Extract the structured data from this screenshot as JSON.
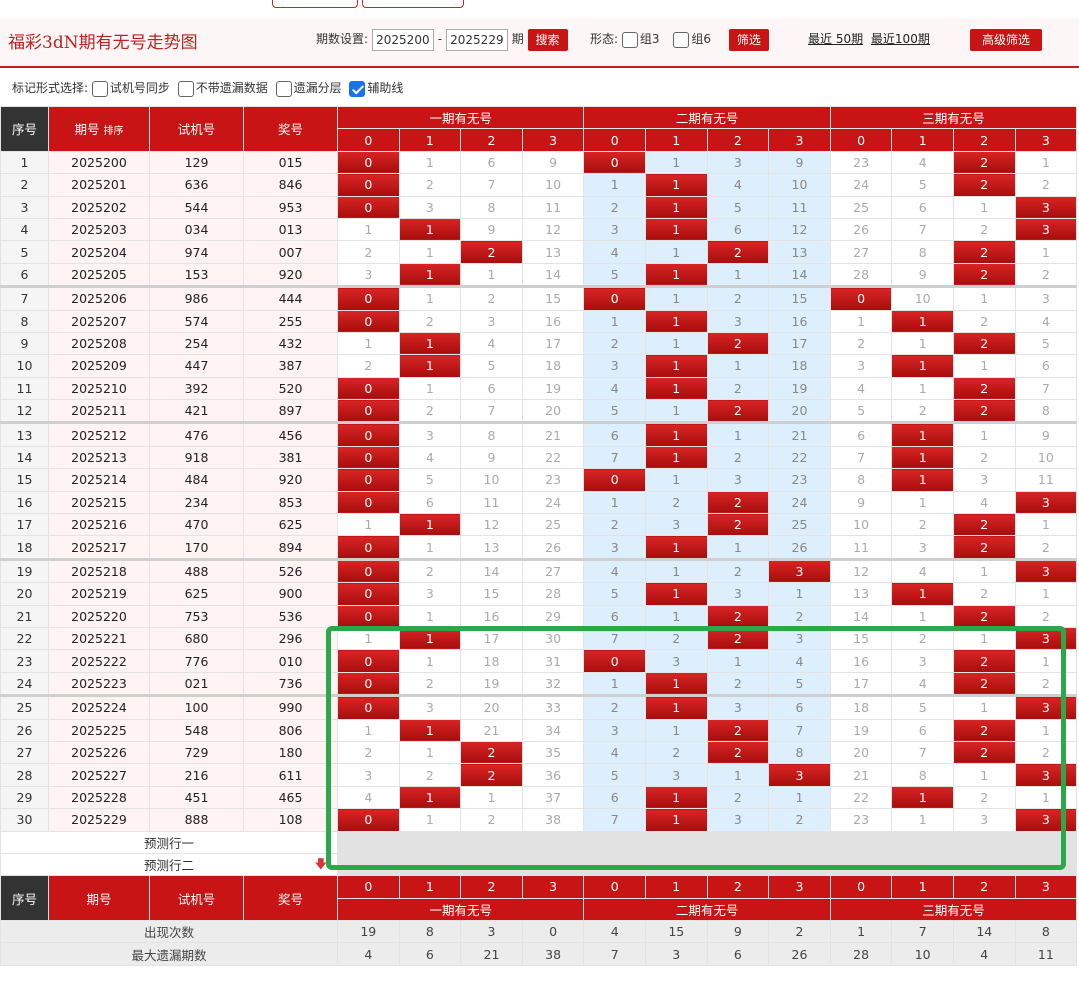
{
  "header": {
    "title": "福彩3dN期有无号走势图",
    "period_label": "期数设置:",
    "period_from": "2025200",
    "period_to": "2025229",
    "period_suffix": "期",
    "search_label": "搜索",
    "form_label": "形态:",
    "group3_label": "组3",
    "group6_label": "组6",
    "filter_label": "筛选",
    "recent50_label": "最近 50期",
    "recent100_label": "最近100期",
    "advanced_label": "高级筛选"
  },
  "options": {
    "label": "标记形式选择:",
    "items": [
      {
        "label": "试机号同步",
        "checked": false
      },
      {
        "label": "不带遗漏数据",
        "checked": false
      },
      {
        "label": "遗漏分层",
        "checked": false
      },
      {
        "label": "辅助线",
        "checked": true
      }
    ]
  },
  "table": {
    "col_seq": "序号",
    "col_issue": "期号",
    "col_sort": "排序",
    "col_trial": "试机号",
    "col_draw": "奖号",
    "groups": [
      "一期有无号",
      "二期有无号",
      "三期有无号"
    ],
    "sub_headers": [
      "0",
      "1",
      "2",
      "3"
    ],
    "rows": [
      {
        "seq": "1",
        "issue": "2025200",
        "trial": "129",
        "draw": "015",
        "g": [
          [
            "0",
            "1",
            "6",
            "9"
          ],
          [
            "0",
            "1",
            "3",
            "9"
          ],
          [
            "23",
            "4",
            "2",
            "1"
          ]
        ],
        "h": [
          0,
          0,
          2
        ]
      },
      {
        "seq": "2",
        "issue": "2025201",
        "trial": "636",
        "draw": "846",
        "g": [
          [
            "0",
            "2",
            "7",
            "10"
          ],
          [
            "1",
            "1",
            "4",
            "10"
          ],
          [
            "24",
            "5",
            "2",
            "2"
          ]
        ],
        "h": [
          0,
          1,
          2
        ]
      },
      {
        "seq": "3",
        "issue": "2025202",
        "trial": "544",
        "draw": "953",
        "g": [
          [
            "0",
            "3",
            "8",
            "11"
          ],
          [
            "2",
            "1",
            "5",
            "11"
          ],
          [
            "25",
            "6",
            "1",
            "3"
          ]
        ],
        "h": [
          0,
          1,
          3
        ]
      },
      {
        "seq": "4",
        "issue": "2025203",
        "trial": "034",
        "draw": "013",
        "g": [
          [
            "1",
            "1",
            "9",
            "12"
          ],
          [
            "3",
            "1",
            "6",
            "12"
          ],
          [
            "26",
            "7",
            "2",
            "3"
          ]
        ],
        "h": [
          1,
          1,
          3
        ]
      },
      {
        "seq": "5",
        "issue": "2025204",
        "trial": "974",
        "draw": "007",
        "g": [
          [
            "2",
            "1",
            "2",
            "13"
          ],
          [
            "4",
            "1",
            "2",
            "13"
          ],
          [
            "27",
            "8",
            "2",
            "1"
          ]
        ],
        "h": [
          2,
          2,
          2
        ]
      },
      {
        "seq": "6",
        "issue": "2025205",
        "trial": "153",
        "draw": "920",
        "g": [
          [
            "3",
            "1",
            "1",
            "14"
          ],
          [
            "5",
            "1",
            "1",
            "14"
          ],
          [
            "28",
            "9",
            "2",
            "2"
          ]
        ],
        "h": [
          1,
          1,
          2
        ]
      },
      {
        "seq": "7",
        "issue": "2025206",
        "trial": "986",
        "draw": "444",
        "g": [
          [
            "0",
            "1",
            "2",
            "15"
          ],
          [
            "0",
            "1",
            "2",
            "15"
          ],
          [
            "0",
            "10",
            "1",
            "3"
          ]
        ],
        "h": [
          0,
          0,
          0
        ]
      },
      {
        "seq": "8",
        "issue": "2025207",
        "trial": "574",
        "draw": "255",
        "g": [
          [
            "0",
            "2",
            "3",
            "16"
          ],
          [
            "1",
            "1",
            "3",
            "16"
          ],
          [
            "1",
            "1",
            "2",
            "4"
          ]
        ],
        "h": [
          0,
          1,
          1
        ]
      },
      {
        "seq": "9",
        "issue": "2025208",
        "trial": "254",
        "draw": "432",
        "g": [
          [
            "1",
            "1",
            "4",
            "17"
          ],
          [
            "2",
            "1",
            "2",
            "17"
          ],
          [
            "2",
            "1",
            "2",
            "5"
          ]
        ],
        "h": [
          1,
          2,
          2
        ]
      },
      {
        "seq": "10",
        "issue": "2025209",
        "trial": "447",
        "draw": "387",
        "g": [
          [
            "2",
            "1",
            "5",
            "18"
          ],
          [
            "3",
            "1",
            "1",
            "18"
          ],
          [
            "3",
            "1",
            "1",
            "6"
          ]
        ],
        "h": [
          1,
          1,
          1
        ]
      },
      {
        "seq": "11",
        "issue": "2025210",
        "trial": "392",
        "draw": "520",
        "g": [
          [
            "0",
            "1",
            "6",
            "19"
          ],
          [
            "4",
            "1",
            "2",
            "19"
          ],
          [
            "4",
            "1",
            "2",
            "7"
          ]
        ],
        "h": [
          0,
          1,
          2
        ]
      },
      {
        "seq": "12",
        "issue": "2025211",
        "trial": "421",
        "draw": "897",
        "g": [
          [
            "0",
            "2",
            "7",
            "20"
          ],
          [
            "5",
            "1",
            "2",
            "20"
          ],
          [
            "5",
            "2",
            "2",
            "8"
          ]
        ],
        "h": [
          0,
          2,
          2
        ]
      },
      {
        "seq": "13",
        "issue": "2025212",
        "trial": "476",
        "draw": "456",
        "g": [
          [
            "0",
            "3",
            "8",
            "21"
          ],
          [
            "6",
            "1",
            "1",
            "21"
          ],
          [
            "6",
            "1",
            "1",
            "9"
          ]
        ],
        "h": [
          0,
          1,
          1
        ]
      },
      {
        "seq": "14",
        "issue": "2025213",
        "trial": "918",
        "draw": "381",
        "g": [
          [
            "0",
            "4",
            "9",
            "22"
          ],
          [
            "7",
            "1",
            "2",
            "22"
          ],
          [
            "7",
            "1",
            "2",
            "10"
          ]
        ],
        "h": [
          0,
          1,
          1
        ]
      },
      {
        "seq": "15",
        "issue": "2025214",
        "trial": "484",
        "draw": "920",
        "g": [
          [
            "0",
            "5",
            "10",
            "23"
          ],
          [
            "0",
            "1",
            "3",
            "23"
          ],
          [
            "8",
            "1",
            "3",
            "11"
          ]
        ],
        "h": [
          0,
          0,
          1
        ]
      },
      {
        "seq": "16",
        "issue": "2025215",
        "trial": "234",
        "draw": "853",
        "g": [
          [
            "0",
            "6",
            "11",
            "24"
          ],
          [
            "1",
            "2",
            "2",
            "24"
          ],
          [
            "9",
            "1",
            "4",
            "3"
          ]
        ],
        "h": [
          0,
          2,
          3
        ]
      },
      {
        "seq": "17",
        "issue": "2025216",
        "trial": "470",
        "draw": "625",
        "g": [
          [
            "1",
            "1",
            "12",
            "25"
          ],
          [
            "2",
            "3",
            "2",
            "25"
          ],
          [
            "10",
            "2",
            "2",
            "1"
          ]
        ],
        "h": [
          1,
          2,
          2
        ]
      },
      {
        "seq": "18",
        "issue": "2025217",
        "trial": "170",
        "draw": "894",
        "g": [
          [
            "0",
            "1",
            "13",
            "26"
          ],
          [
            "3",
            "1",
            "1",
            "26"
          ],
          [
            "11",
            "3",
            "2",
            "2"
          ]
        ],
        "h": [
          0,
          1,
          2
        ]
      },
      {
        "seq": "19",
        "issue": "2025218",
        "trial": "488",
        "draw": "526",
        "g": [
          [
            "0",
            "2",
            "14",
            "27"
          ],
          [
            "4",
            "1",
            "2",
            "3"
          ],
          [
            "12",
            "4",
            "1",
            "3"
          ]
        ],
        "h": [
          0,
          3,
          3
        ]
      },
      {
        "seq": "20",
        "issue": "2025219",
        "trial": "625",
        "draw": "900",
        "g": [
          [
            "0",
            "3",
            "15",
            "28"
          ],
          [
            "5",
            "1",
            "3",
            "1"
          ],
          [
            "13",
            "1",
            "2",
            "1"
          ]
        ],
        "h": [
          0,
          1,
          1
        ]
      },
      {
        "seq": "21",
        "issue": "2025220",
        "trial": "753",
        "draw": "536",
        "g": [
          [
            "0",
            "1",
            "16",
            "29"
          ],
          [
            "6",
            "1",
            "2",
            "2"
          ],
          [
            "14",
            "1",
            "2",
            "2"
          ]
        ],
        "h": [
          0,
          2,
          2
        ]
      },
      {
        "seq": "22",
        "issue": "2025221",
        "trial": "680",
        "draw": "296",
        "g": [
          [
            "1",
            "1",
            "17",
            "30"
          ],
          [
            "7",
            "2",
            "2",
            "3"
          ],
          [
            "15",
            "2",
            "1",
            "3"
          ]
        ],
        "h": [
          1,
          2,
          3
        ]
      },
      {
        "seq": "23",
        "issue": "2025222",
        "trial": "776",
        "draw": "010",
        "g": [
          [
            "0",
            "1",
            "18",
            "31"
          ],
          [
            "0",
            "3",
            "1",
            "4"
          ],
          [
            "16",
            "3",
            "2",
            "1"
          ]
        ],
        "h": [
          0,
          0,
          2
        ]
      },
      {
        "seq": "24",
        "issue": "2025223",
        "trial": "021",
        "draw": "736",
        "g": [
          [
            "0",
            "2",
            "19",
            "32"
          ],
          [
            "1",
            "1",
            "2",
            "5"
          ],
          [
            "17",
            "4",
            "2",
            "2"
          ]
        ],
        "h": [
          0,
          1,
          2
        ]
      },
      {
        "seq": "25",
        "issue": "2025224",
        "trial": "100",
        "draw": "990",
        "g": [
          [
            "0",
            "3",
            "20",
            "33"
          ],
          [
            "2",
            "1",
            "3",
            "6"
          ],
          [
            "18",
            "5",
            "1",
            "3"
          ]
        ],
        "h": [
          0,
          1,
          3
        ]
      },
      {
        "seq": "26",
        "issue": "2025225",
        "trial": "548",
        "draw": "806",
        "g": [
          [
            "1",
            "1",
            "21",
            "34"
          ],
          [
            "3",
            "1",
            "2",
            "7"
          ],
          [
            "19",
            "6",
            "2",
            "1"
          ]
        ],
        "h": [
          1,
          2,
          2
        ]
      },
      {
        "seq": "27",
        "issue": "2025226",
        "trial": "729",
        "draw": "180",
        "g": [
          [
            "2",
            "1",
            "2",
            "35"
          ],
          [
            "4",
            "2",
            "2",
            "8"
          ],
          [
            "20",
            "7",
            "2",
            "2"
          ]
        ],
        "h": [
          2,
          2,
          2
        ]
      },
      {
        "seq": "28",
        "issue": "2025227",
        "trial": "216",
        "draw": "611",
        "g": [
          [
            "3",
            "2",
            "2",
            "36"
          ],
          [
            "5",
            "3",
            "1",
            "3"
          ],
          [
            "21",
            "8",
            "1",
            "3"
          ]
        ],
        "h": [
          2,
          3,
          3
        ]
      },
      {
        "seq": "29",
        "issue": "2025228",
        "trial": "451",
        "draw": "465",
        "g": [
          [
            "4",
            "1",
            "1",
            "37"
          ],
          [
            "6",
            "1",
            "2",
            "1"
          ],
          [
            "22",
            "1",
            "2",
            "1"
          ]
        ],
        "h": [
          1,
          1,
          1
        ]
      },
      {
        "seq": "30",
        "issue": "2025229",
        "trial": "888",
        "draw": "108",
        "g": [
          [
            "0",
            "1",
            "2",
            "38"
          ],
          [
            "7",
            "1",
            "3",
            "2"
          ],
          [
            "23",
            "1",
            "3",
            "3"
          ]
        ],
        "h": [
          0,
          1,
          3
        ]
      }
    ],
    "predict1": "预测行一",
    "predict2": "预测行二",
    "stat_count_label": "出现次数",
    "stat_count": [
      "19",
      "8",
      "3",
      "0",
      "4",
      "15",
      "9",
      "2",
      "1",
      "7",
      "14",
      "8"
    ],
    "stat_max_label": "最大遗漏期数",
    "stat_max": [
      "4",
      "6",
      "21",
      "38",
      "7",
      "3",
      "6",
      "26",
      "28",
      "10",
      "4",
      "11"
    ]
  },
  "colors": {
    "accent": "#c81414",
    "highlight": "#2aa84a",
    "group2_bg": "#ddeefc"
  }
}
